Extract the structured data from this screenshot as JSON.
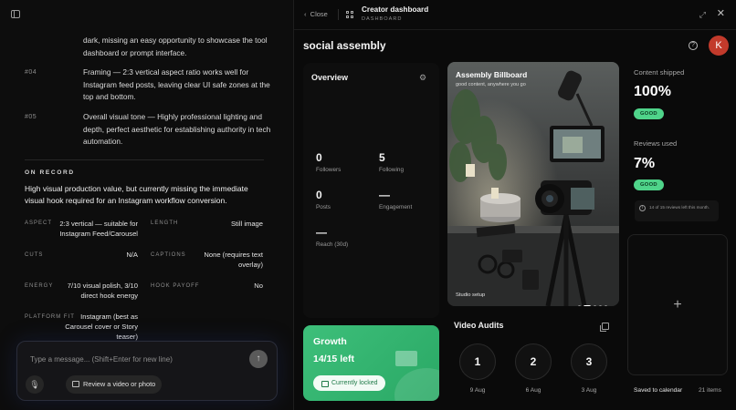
{
  "left": {
    "notes": [
      {
        "num": "",
        "text": "dark, missing an easy opportunity to showcase the tool dashboard or prompt interface."
      },
      {
        "num": "#04",
        "text": "Framing — 2:3 vertical aspect ratio works well for Instagram feed posts, leaving clear UI safe zones at the top and bottom."
      },
      {
        "num": "#05",
        "text": "Overall visual tone — Highly professional lighting and depth, perfect aesthetic for establishing authority in tech automation."
      }
    ],
    "on_record": "ON RECORD",
    "summary": "High visual production value, but currently missing the immediate visual hook required for an Instagram workflow conversion.",
    "fields": {
      "aspect_label": "ASPECT",
      "aspect_value": "2:3 vertical — suitable for Instagram Feed/Carousel",
      "length_label": "LENGTH",
      "length_value": "Still image",
      "cuts_label": "CUTS",
      "cuts_value": "N/A",
      "captions_label": "CAPTIONS",
      "captions_value": "None (requires text overlay)",
      "energy_label": "ENERGY",
      "energy_value": "7/10 visual polish, 3/10 direct hook energy",
      "hook_label": "HOOK PAYOFF",
      "hook_value": "No",
      "platform_label": "PLATFORM FIT",
      "platform_value": "Instagram (best as Carousel cover or Story teaser)"
    },
    "composer": {
      "placeholder": "Type a message... (Shift+Enter for new line)",
      "review_label": "Review a video or photo",
      "send_icon": "↑",
      "mic_icon": "🎙"
    }
  },
  "topbar": {
    "close_label": "Close",
    "title": "Creator dashboard",
    "subtitle": "DASHBOARD",
    "expand_icon": "⤢",
    "close_icon": "✕"
  },
  "brand": "social assembly",
  "help_icon": "?",
  "avatar_initial": "K",
  "overview": {
    "title": "Overview",
    "gear_icon": "⚙",
    "stats": [
      {
        "value": "0",
        "label": "Followers"
      },
      {
        "value": "5",
        "label": "Following"
      },
      {
        "value": "0",
        "label": "Posts"
      },
      {
        "value": "—",
        "label": "Engagement"
      },
      {
        "value": "—",
        "label": "Reach (30d)"
      }
    ]
  },
  "growth": {
    "title": "Growth",
    "count": "14/15 left",
    "locked_label": "Currently locked"
  },
  "billboard": {
    "title": "Assembly Billboard",
    "subtitle": "good content, anywhere you go",
    "caption": "Studio setup",
    "slide_index": 2,
    "slide_count": 5
  },
  "video_audits": {
    "title": "Video Audits",
    "items": [
      {
        "num": "1",
        "date": "9 Aug"
      },
      {
        "num": "2",
        "date": "6 Aug"
      },
      {
        "num": "3",
        "date": "3 Aug"
      }
    ]
  },
  "content_shipped": {
    "label": "Content shipped",
    "value": "100%",
    "badge": "GOOD"
  },
  "reviews_used": {
    "label": "Reviews used",
    "value": "7%",
    "badge": "GOOD",
    "note": "14 of 15 reviews left this month."
  },
  "calendar": {
    "plus": "+",
    "label": "Saved to calendar",
    "count": "21 items"
  },
  "colors": {
    "accent_green": "#4fd48a",
    "growth_green": "#3dbf7a",
    "avatar_red": "#c23a2b"
  }
}
